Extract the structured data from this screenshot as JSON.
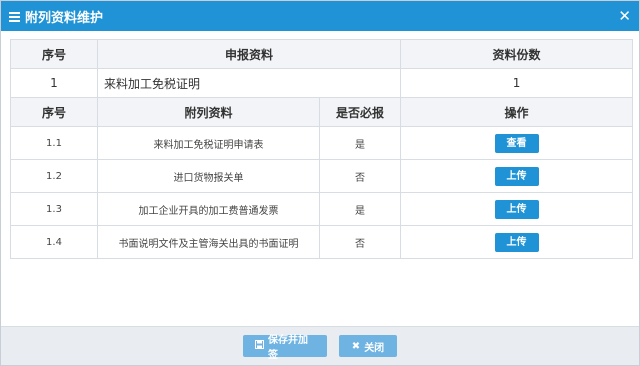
{
  "dialog": {
    "title": "附列资料维护",
    "close_glyph": "✕"
  },
  "table": {
    "main_headers": {
      "seq": "序号",
      "report": "申报资料",
      "copies": "资料份数"
    },
    "main_row": {
      "seq": "1",
      "report": "来料加工免税证明",
      "copies": "1"
    },
    "sub_headers": {
      "seq": "序号",
      "attachment": "附列资料",
      "required": "是否必报",
      "action": "操作"
    },
    "sub_rows": [
      {
        "seq": "1.1",
        "attachment": "来料加工免税证明申请表",
        "required": "是",
        "action": "查看"
      },
      {
        "seq": "1.2",
        "attachment": "进口货物报关单",
        "required": "否",
        "action": "上传"
      },
      {
        "seq": "1.3",
        "attachment": "加工企业开具的加工费普通发票",
        "required": "是",
        "action": "上传"
      },
      {
        "seq": "1.4",
        "attachment": "书面说明文件及主管海关出具的书面证明",
        "required": "否",
        "action": "上传"
      }
    ]
  },
  "footer": {
    "save_label": "保存并加签",
    "close_label": "关闭",
    "save_icon": "save-icon",
    "close_icon": "x-icon"
  },
  "colors": {
    "accent": "#1f93d5",
    "footer_button": "#6fb3e3",
    "header_bg": "#f2f4f7"
  }
}
